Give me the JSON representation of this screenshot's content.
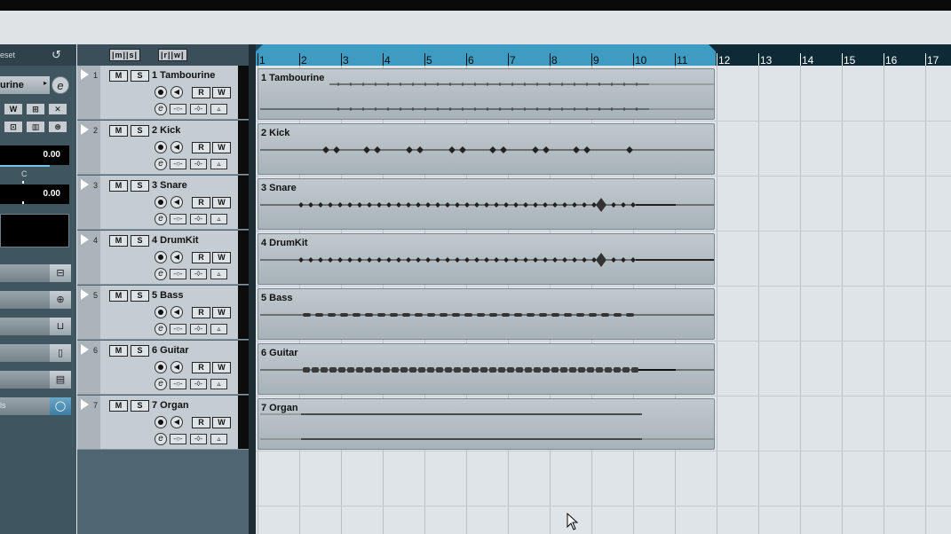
{
  "inspector": {
    "header_label": "eset",
    "reset_icon": "↺",
    "track_name": "urine",
    "track_arrow": "▸",
    "edit_icon": "e",
    "buttons": [
      "W",
      "⊞",
      "✕",
      "⊡",
      "▥",
      "⊛"
    ],
    "volume_value": "0.00",
    "pan_label": "C",
    "pan_value": "0.00",
    "sections": [
      {
        "label": "",
        "icon": "⊟"
      },
      {
        "label": "",
        "icon": "⊕"
      },
      {
        "label": "",
        "icon": "⊔"
      },
      {
        "label": "",
        "icon": "▯"
      },
      {
        "label": "",
        "icon": "▤"
      },
      {
        "label": "ls",
        "icon": "◯",
        "active": true
      }
    ]
  },
  "tracklist_header": {
    "group1": "|m||s|",
    "group2": "|r||w|"
  },
  "tracks": [
    {
      "number": "1",
      "name": "1 Tambourine",
      "mute": "M",
      "solo": "S",
      "read": "R",
      "write": "W",
      "edit": "e"
    },
    {
      "number": "2",
      "name": "2 Kick",
      "mute": "M",
      "solo": "S",
      "read": "R",
      "write": "W",
      "edit": "e"
    },
    {
      "number": "3",
      "name": "3 Snare",
      "mute": "M",
      "solo": "S",
      "read": "R",
      "write": "W",
      "edit": "e"
    },
    {
      "number": "4",
      "name": "4 DrumKit",
      "mute": "M",
      "solo": "S",
      "read": "R",
      "write": "W",
      "edit": "e"
    },
    {
      "number": "5",
      "name": "5 Bass",
      "mute": "M",
      "solo": "S",
      "read": "R",
      "write": "W",
      "edit": "e"
    },
    {
      "number": "6",
      "name": "6 Guitar",
      "mute": "M",
      "solo": "S",
      "read": "R",
      "write": "W",
      "edit": "e"
    },
    {
      "number": "7",
      "name": "7 Organ",
      "mute": "M",
      "solo": "S",
      "read": "R",
      "write": "W",
      "edit": "e"
    }
  ],
  "ruler": {
    "bars": [
      "1",
      "2",
      "3",
      "4",
      "5",
      "6",
      "7",
      "8",
      "9",
      "10",
      "11",
      "12",
      "13",
      "14",
      "15",
      "16",
      "17"
    ]
  },
  "events": [
    {
      "name": "1 Tambourine",
      "track": 1
    },
    {
      "name": "2 Kick",
      "track": 2
    },
    {
      "name": "3 Snare",
      "track": 3
    },
    {
      "name": "4 DrumKit",
      "track": 4
    },
    {
      "name": "5 Bass",
      "track": 5
    },
    {
      "name": "6 Guitar",
      "track": 6
    },
    {
      "name": "7 Organ",
      "track": 7
    }
  ],
  "colors": {
    "locator": "#3e9bc2",
    "ruler_bg": "#0e2a36",
    "event_bg": "#b4bec4",
    "track_bg": "#c5cdd3",
    "inspector_bg": "#3f5560"
  }
}
